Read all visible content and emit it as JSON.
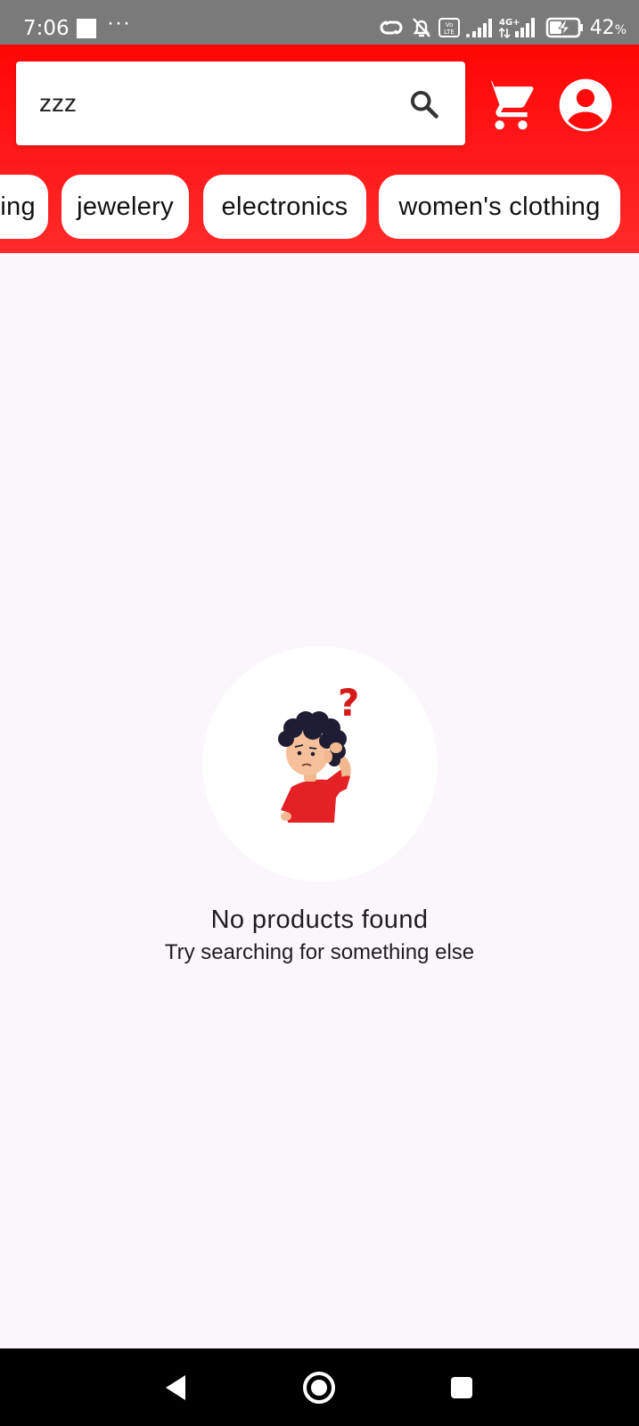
{
  "status_bar": {
    "time": "7:06",
    "more": "···",
    "battery_pct": "42",
    "battery_unit": "%",
    "network": "4G+"
  },
  "search": {
    "value": "zzz",
    "placeholder": ""
  },
  "categories": [
    {
      "label": "men's clothing",
      "visible_text": "ing"
    },
    {
      "label": "jewelery"
    },
    {
      "label": "electronics"
    },
    {
      "label": "women's clothing"
    }
  ],
  "empty_state": {
    "title": "No products found",
    "subtitle": "Try searching for something else"
  },
  "colors": {
    "header_red": "#ff0606",
    "background": "#fbf6fc",
    "shirt_red": "#e42125",
    "question_mark": "#d61919"
  },
  "icons": {
    "search": "search-icon",
    "cart": "cart-icon",
    "profile": "account-circle-icon",
    "nav_back": "back-triangle-icon",
    "nav_home": "home-circle-icon",
    "nav_recents": "recents-square-icon"
  }
}
